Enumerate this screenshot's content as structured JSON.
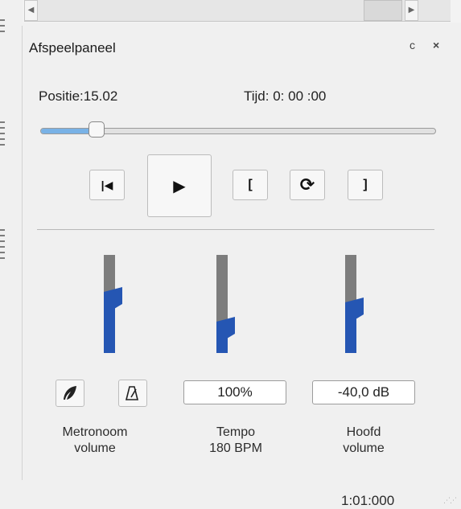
{
  "panel": {
    "title": "Afspeelpaneel",
    "float_icon": "ᴄ",
    "close_icon": "×"
  },
  "scrollbar": {
    "left_arrow": "◀",
    "right_arrow": "▶"
  },
  "position": {
    "text": "Positie:15.02"
  },
  "time": {
    "text": "Tijd: 0: 00 :00"
  },
  "seek": {
    "value_fraction": 0.14
  },
  "transport": {
    "rewind_glyph": "|◀",
    "play_glyph": "▶",
    "loop_start_glyph": "[",
    "loop_glyph": "⟳",
    "loop_end_glyph": "]"
  },
  "faders": {
    "metronome": {
      "level_fraction": 0.62
    },
    "tempo": {
      "level_fraction": 0.32
    },
    "master": {
      "level_fraction": 0.52
    }
  },
  "values": {
    "tempo": "100%",
    "master": "-40,0 dB"
  },
  "labels": {
    "metronome_line1": "Metronoom",
    "metronome_line2": "volume",
    "tempo_line1": "Tempo",
    "tempo_line2": "180 BPM",
    "master_line1": "Hoofd",
    "master_line2": "volume"
  },
  "statusbar": {
    "time": "1:01:000"
  },
  "colors": {
    "accent": "#2556b3",
    "fader_top": "#7d7d7d",
    "slider_fill": "#79b2e6"
  }
}
